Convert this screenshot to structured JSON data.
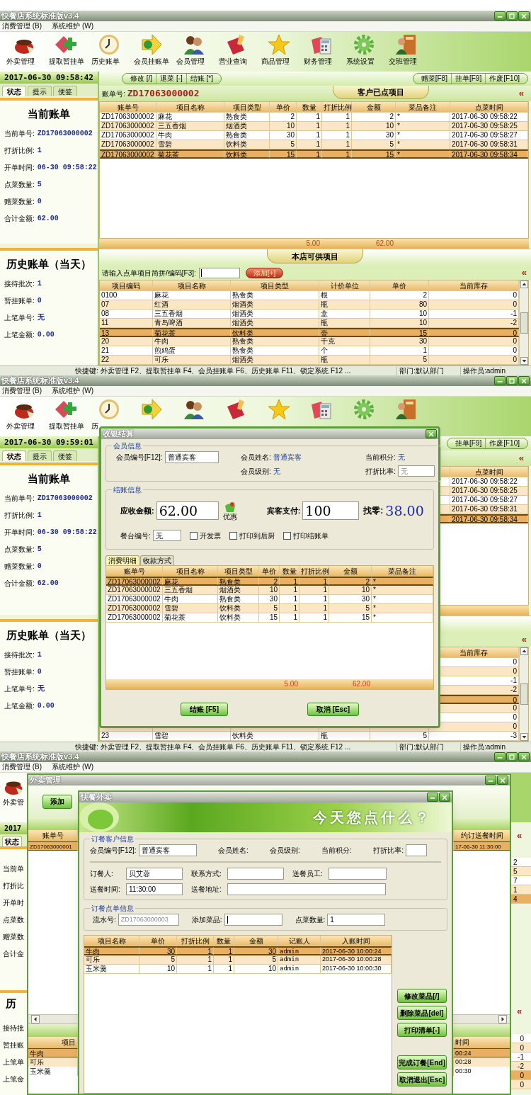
{
  "screen_1": {
    "window": {
      "title": "快餐店系统标准版v3.4"
    },
    "menu": [
      "消费管理 (B)",
      "系统维护 (W)"
    ],
    "toolbar_labels": [
      "外卖管理",
      "提取暂挂单",
      "历史账单",
      "会员挂账单",
      "会员管理",
      "营业查询",
      "商品管理",
      "财务管理",
      "系统设置",
      "交班管理"
    ],
    "sidebar": {
      "clock": "2017-06-30 09:58:42",
      "tabs": [
        {
          "label": "状态",
          "selected": true
        },
        {
          "label": "提示",
          "selected": false
        },
        {
          "label": "便签",
          "selected": false
        }
      ],
      "current": {
        "title": "当前账单",
        "fields": [
          {
            "label": "当前单号:",
            "value": "ZD17063000002"
          },
          {
            "label": "打折比例:",
            "value": "1"
          },
          {
            "label": "开单时间:",
            "value": "06-30 09:58:22"
          },
          {
            "label": "点菜数量:",
            "value": "5"
          },
          {
            "label": "赠菜数量:",
            "value": "0"
          },
          {
            "label": "合计金额:",
            "value": "62.00"
          }
        ]
      },
      "history": {
        "title": "历史账单（当天）",
        "fields": [
          {
            "label": "接待批次:",
            "value": "1"
          },
          {
            "label": "暂挂账单:",
            "value": "0"
          },
          {
            "label": "上笔单号:",
            "value": "无"
          },
          {
            "label": "上笔金额:",
            "value": "0.00"
          }
        ]
      }
    },
    "main": {
      "left_actions": [
        "修改 [/]",
        "退菜 [-]",
        "结账 [*]"
      ],
      "right_actions": [
        "赠菜[F8]",
        "挂单[F9]",
        "作废[F10]"
      ],
      "ordered": {
        "bill_label": "账单号:",
        "bill_no": "ZD17063000002",
        "title": "客户已点项目",
        "collapse": "«",
        "headers": {
          "bill": "账单号",
          "name": "项目名称",
          "type": "项目类型",
          "price": "单价",
          "qty": "数量",
          "discount": "打折比例",
          "amount": "金额",
          "note": "菜品备注",
          "time": "点菜时间"
        },
        "rows": [
          {
            "bill": "ZD17063000002",
            "name": "麻花",
            "type": "熟食类",
            "price": "2",
            "qty": "1",
            "discount": "1",
            "amount": "2",
            "note": "*",
            "time": "2017-06-30 09:58:22",
            "selected": false
          },
          {
            "bill": "ZD17063000002",
            "name": "三五香烟",
            "type": "烟酒类",
            "price": "10",
            "qty": "1",
            "discount": "1",
            "amount": "10",
            "note": "*",
            "time": "2017-06-30 09:58:25",
            "selected": false
          },
          {
            "bill": "ZD17063000002",
            "name": "牛肉",
            "type": "熟食类",
            "price": "30",
            "qty": "1",
            "discount": "1",
            "amount": "30",
            "note": "*",
            "time": "2017-06-30 09:58:27",
            "selected": false
          },
          {
            "bill": "ZD17063000002",
            "name": "雪碧",
            "type": "饮料类",
            "price": "5",
            "qty": "1",
            "discount": "1",
            "amount": "5",
            "note": "*",
            "time": "2017-06-30 09:58:31",
            "selected": false
          },
          {
            "bill": "ZD17063000002",
            "name": "菊花茶",
            "type": "饮料类",
            "price": "15",
            "qty": "1",
            "discount": "1",
            "amount": "15",
            "note": "*",
            "time": "2017-06-30 09:58:34",
            "selected": true
          }
        ],
        "totals": {
          "qty": "5.00",
          "amount": "62.00"
        }
      },
      "catalog": {
        "title": "本店可供项目",
        "search": {
          "label": "请输入点单项目简拼/编码[F3]:"
        },
        "add_button": "添加[+]",
        "collapse": "«",
        "headers": {
          "code": "项目编码",
          "name": "项目名称",
          "type": "项目类型",
          "unit": "计价单位",
          "price": "单价",
          "stock": "当前库存"
        },
        "rows": [
          {
            "code": "0100",
            "name": "麻花",
            "type": "熟食类",
            "unit": "根",
            "price": "2",
            "stock": "0",
            "selected": false
          },
          {
            "code": "07",
            "name": "红酒",
            "type": "烟酒类",
            "unit": "瓶",
            "price": "80",
            "stock": "0",
            "selected": false
          },
          {
            "code": "08",
            "name": "三五香烟",
            "type": "烟酒类",
            "unit": "盒",
            "price": "10",
            "stock": "-1",
            "selected": false
          },
          {
            "code": "11",
            "name": "青岛啤酒",
            "type": "烟酒类",
            "unit": "瓶",
            "price": "10",
            "stock": "-2",
            "selected": false
          },
          {
            "code": "13",
            "name": "菊花茶",
            "type": "饮料类",
            "unit": "壶",
            "price": "15",
            "stock": "0",
            "selected": true
          },
          {
            "code": "20",
            "name": "牛肉",
            "type": "熟食类",
            "unit": "千克",
            "price": "30",
            "stock": "0",
            "selected": false
          },
          {
            "code": "21",
            "name": "煎鸡蛋",
            "type": "熟食类",
            "unit": "个",
            "price": "1",
            "stock": "0",
            "selected": false
          },
          {
            "code": "22",
            "name": "可乐",
            "type": "烟酒类",
            "unit": "瓶",
            "price": "5",
            "stock": "0",
            "selected": false
          }
        ]
      }
    },
    "status_bar": {
      "shortcuts": "快捷键: 外卖管理 F2、提取暂挂单 F4、会员挂账单 F6、历史账单 F11、锁定系统 F12 ...",
      "department": "部门:默认部门",
      "operator": "操作员:admin"
    }
  },
  "screen_2": {
    "window": {
      "title": "快餐店系统标准版v3.4"
    },
    "menu": [
      "消费管理 (B)",
      "系统维护 (W)"
    ],
    "toolbar_labels": [
      "外卖管理",
      "提取暂挂单",
      "历"
    ],
    "sidebar": {
      "clock": "2017-06-30 09:59:01",
      "tabs": [
        {
          "label": "状态",
          "selected": true
        },
        {
          "label": "提示",
          "selected": false
        },
        {
          "label": "便签",
          "selected": false
        }
      ],
      "current": {
        "title": "当前账单",
        "fields": [
          {
            "label": "当前单号:",
            "value": "ZD17063000002"
          },
          {
            "label": "打折比例:",
            "value": "1"
          },
          {
            "label": "开单时间:",
            "value": "06-30 09:58:22"
          },
          {
            "label": "点菜数量:",
            "value": "5"
          },
          {
            "label": "赠菜数量:",
            "value": "0"
          },
          {
            "label": "合计金额:",
            "value": "62.00"
          }
        ]
      },
      "history": {
        "title": "历史账单（当天）",
        "fields": [
          {
            "label": "接待批次:",
            "value": "1"
          },
          {
            "label": "暂挂账单:",
            "value": "0"
          },
          {
            "label": "上笔单号:",
            "value": "无"
          },
          {
            "label": "上笔金额:",
            "value": "0.00"
          }
        ]
      }
    },
    "main": {
      "right_actions": [
        "挂单[F9]",
        "作废[F10]"
      ],
      "ordered": {
        "collapse": "«",
        "headers": {
          "time": "点菜时间"
        },
        "rows": [
          {
            "time": "2017-06-30 09:58:22",
            "selected": false
          },
          {
            "time": "2017-06-30 09:58:25",
            "selected": false
          },
          {
            "time": "2017-06-30 09:58:27",
            "selected": false
          },
          {
            "time": "2017-06-30 09:58:31",
            "selected": false
          },
          {
            "time": "2017-06-30 09:58:34",
            "selected": true
          }
        ]
      },
      "catalog": {
        "collapse": "«",
        "headers": {
          "stock": "当前库存"
        },
        "rows": [
          {
            "stock": "0",
            "selected": false
          },
          {
            "stock": "0",
            "selected": false
          },
          {
            "stock": "-1",
            "selected": false
          },
          {
            "stock": "-2",
            "selected": false
          },
          {
            "stock": "0",
            "selected": true
          },
          {
            "stock": "0",
            "selected": false
          },
          {
            "stock": "0",
            "selected": false
          },
          {
            "stock": "0",
            "selected": false
          },
          {
            "code": "23",
            "name": "雪碧",
            "type": "饮料类",
            "unit": "瓶",
            "price": "5",
            "stock": "-3",
            "selected": false
          }
        ]
      }
    },
    "status_bar": {
      "shortcuts": "快捷键: 外卖管理 F2、提取暂挂单 F4、会员挂账单 F6、历史账单 F11、锁定系统 F12 ...",
      "department": "部门:默认部门",
      "operator": "操作员:admin"
    },
    "checkout_dialog": {
      "title": "收银结算",
      "member": {
        "legend": "会员信息",
        "member_no": {
          "label": "会员编号[F12]:",
          "value": "普通宾客"
        },
        "member_name": {
          "label": "会员姓名:",
          "value": "普通宾客"
        },
        "points": {
          "label": "当前积分:",
          "value": "无"
        },
        "member_level": {
          "label": "会员级别:",
          "value": "无"
        },
        "discount": {
          "label": "打折比率:",
          "value": "无",
          "disabled": true
        }
      },
      "settlement": {
        "legend": "结账信息",
        "receivable": {
          "label": "应收金额:",
          "value": "62.00"
        },
        "discount_button": "优惠",
        "paid": {
          "label": "宾客支付:",
          "value": "100"
        },
        "change": {
          "label": "找零:",
          "value": "38.00"
        },
        "table_no": {
          "label": "餐台编号:",
          "value": "无"
        },
        "options": [
          {
            "label": "开发票",
            "checked": false
          },
          {
            "label": "打印到后厨",
            "checked": false
          },
          {
            "label": "打印结账单",
            "checked": false
          }
        ]
      },
      "tabs": [
        {
          "label": "消费明细",
          "selected": true
        },
        {
          "label": "收款方式",
          "selected": false
        }
      ],
      "table": {
        "headers": [
          "账单号",
          "项目名称",
          "项目类型",
          "单价",
          "数量",
          "打折比例",
          "金额",
          "菜品备注"
        ],
        "rows": [
          {
            "cells": [
              "ZD17063000002",
              "麻花",
              "熟食类",
              "2",
              "1",
              "1",
              "2",
              "*"
            ],
            "selected": true
          },
          {
            "cells": [
              "ZD17063000002",
              "三五香烟",
              "烟酒类",
              "10",
              "1",
              "1",
              "10",
              "*"
            ],
            "selected": false
          },
          {
            "cells": [
              "ZD17063000002",
              "牛肉",
              "熟食类",
              "30",
              "1",
              "1",
              "30",
              "*"
            ],
            "selected": false
          },
          {
            "cells": [
              "ZD17063000002",
              "雪碧",
              "饮料类",
              "5",
              "1",
              "1",
              "5",
              "*"
            ],
            "selected": false
          },
          {
            "cells": [
              "ZD17063000002",
              "菊花茶",
              "饮料类",
              "15",
              "1",
              "1",
              "15",
              "*"
            ],
            "selected": false
          }
        ],
        "totals": {
          "qty": "5.00",
          "amount": "62.00"
        }
      },
      "buttons": [
        "结账 [F5]",
        "取消 [Esc]"
      ]
    }
  },
  "screen_3": {
    "window": {
      "title": "快餐店系统标准版v3.4"
    },
    "menu": [
      "消费管理 (B)",
      "系统维护 (W)"
    ],
    "toolbar_labels": [
      "外卖管"
    ],
    "sidebar": {
      "clock": "2017",
      "tabs": [
        {
          "label": "状态",
          "selected": true
        }
      ],
      "current_labels": [
        "当前单",
        "打折比",
        "开单时",
        "点菜数",
        "赠菜数",
        "合计金"
      ],
      "history_title": "历",
      "history_labels": [
        "接待批",
        "暂挂账",
        "上笔单",
        "上笔金"
      ]
    },
    "right_edge": {
      "ordered_collapse": "«",
      "time_fragments": [
        {
          "text": "2",
          "selected": false
        },
        {
          "text": "5",
          "selected": false
        },
        {
          "text": "7",
          "selected": false
        },
        {
          "text": "1",
          "selected": false
        },
        {
          "text": "4",
          "selected": true
        }
      ],
      "catalog_collapse": "«",
      "stock_fragments": [
        {
          "text": "0",
          "selected": false
        },
        {
          "text": "0",
          "selected": false
        },
        {
          "text": "-1",
          "selected": false
        },
        {
          "text": "-2",
          "selected": false
        },
        {
          "text": "0",
          "selected": true
        },
        {
          "text": "0",
          "selected": false
        }
      ]
    },
    "delivery_list": {
      "title": "外卖管理",
      "add_button": "添加",
      "headers": {
        "bill": "账单号",
        "time": "约订送餐时间"
      },
      "rows": [
        {
          "bill": "ZD17063000001",
          "time": "17-06-30 11:30:00",
          "selected": true
        }
      ],
      "items": {
        "headers": {
          "name": "项目",
          "time": "时间"
        },
        "rows": [
          {
            "name": "牛肉",
            "time": "00:24",
            "selected": true
          },
          {
            "name": "可乐",
            "time": "00:28",
            "selected": false
          },
          {
            "name": "玉米羹",
            "time": "00:30",
            "selected": false
          }
        ]
      }
    },
    "order_dialog": {
      "title": "快餐外卖",
      "banner": "今天您点什么？",
      "customer": {
        "legend": "订餐客户信息",
        "member_no": {
          "label": "会员编号[F12]:",
          "value": "普通宾客"
        },
        "member_name": {
          "label": "会员姓名:"
        },
        "member_level": {
          "label": "会员级别:"
        },
        "points": {
          "label": "当前积分:"
        },
        "discount": {
          "label": "打折比率:"
        },
        "orderer": {
          "label": "订餐人:",
          "value": "贝艾蓉"
        },
        "contact": {
          "label": "联系方式:"
        },
        "courier": {
          "label": "送餐员工:"
        },
        "delivery_time": {
          "label": "送餐时间:",
          "value": "11:30:00"
        },
        "address": {
          "label": "送餐地址:"
        }
      },
      "order": {
        "legend": "订餐点单信息",
        "serial": {
          "label": "流水号:",
          "value": "ZD17063000003",
          "disabled": true
        },
        "add_dish": {
          "label": "添加菜品:"
        },
        "quantity": {
          "label": "点菜数量:",
          "value": "1"
        },
        "table": {
          "headers": [
            "项目名称",
            "单价",
            "打折比例",
            "数量",
            "金额",
            "记账人",
            "入账时间"
          ],
          "rows": [
            {
              "cells": [
                "牛肉",
                "30",
                "1",
                "1",
                "30",
                "admin",
                "2017-06-30 10:00:24"
              ],
              "selected": true
            },
            {
              "cells": [
                "可乐",
                "5",
                "1",
                "1",
                "5",
                "admin",
                "2017-06-30 10:00:28"
              ],
              "selected": false
            },
            {
              "cells": [
                "玉米羹",
                "10",
                "1",
                "1",
                "10",
                "admin",
                "2017-06-30 10:00:30"
              ],
              "selected": false
            }
          ]
        }
      },
      "buttons": [
        "修改菜品[/]",
        "删除菜品[del]",
        "打印清单[-]",
        "完成订餐[End]",
        "取消退出[Esc]"
      ]
    }
  }
}
